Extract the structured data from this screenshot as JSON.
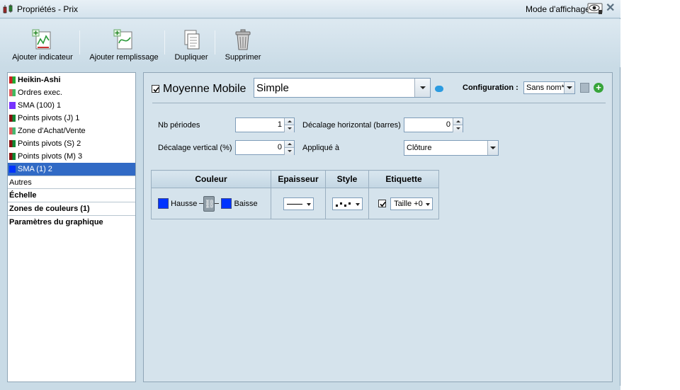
{
  "window": {
    "title": "Propriétés - Prix",
    "mode_label": "Mode d'affichage",
    "close_glyph": "✕"
  },
  "toolbar": {
    "add_indicator": "Ajouter indicateur",
    "add_fill": "Ajouter remplissage",
    "duplicate": "Dupliquer",
    "delete": "Supprimer"
  },
  "sidebar": {
    "items": [
      {
        "label": "Heikin-Ashi",
        "bold": true,
        "swatch": [
          "#cc2222",
          "#22aa33"
        ]
      },
      {
        "label": "Ordres exec.",
        "bold": false,
        "swatch": [
          "#e06060",
          "#40bb60"
        ]
      },
      {
        "label": "SMA (100) 1",
        "bold": false,
        "swatch": [
          "#7733ff",
          "#7733ff"
        ]
      },
      {
        "label": "Points pivots (J) 1",
        "bold": false,
        "swatch": [
          "#881111",
          "#118833"
        ]
      },
      {
        "label": "Zone d'Achat/Vente",
        "bold": false,
        "swatch": [
          "#e05a5a",
          "#45b870"
        ]
      },
      {
        "label": "Points pivots (S) 2",
        "bold": false,
        "swatch": [
          "#881111",
          "#118833"
        ]
      },
      {
        "label": "Points pivots (M) 3",
        "bold": false,
        "swatch": [
          "#881111",
          "#118833"
        ]
      },
      {
        "label": "SMA (1) 2",
        "bold": false,
        "selected": true,
        "swatch": [
          "#0033ff",
          "#0033ff"
        ]
      }
    ],
    "sections": [
      {
        "label": "Autres",
        "bold": false
      },
      {
        "label": "Échelle",
        "bold": true
      },
      {
        "label": "Zones de couleurs (1)",
        "bold": true
      },
      {
        "label": "Paramètres du graphique",
        "bold": true
      }
    ]
  },
  "indicator": {
    "enabled": true,
    "name": "Moyenne Mobile",
    "type": "Simple",
    "config_label": "Configuration :",
    "config_value": "Sans nom*"
  },
  "params": {
    "periods_label": "Nb périodes",
    "periods_value": "1",
    "hshift_label": "Décalage horizontal (barres)",
    "hshift_value": "0",
    "vshift_label": "Décalage vertical (%)",
    "vshift_value": "0",
    "applied_label": "Appliqué à",
    "applied_value": "Clôture"
  },
  "style_table": {
    "headers": [
      "Couleur",
      "Epaisseur",
      "Style",
      "Etiquette"
    ],
    "up_label": "Hausse",
    "down_label": "Baisse",
    "up_color": "#0033ff",
    "down_color": "#0033ff",
    "label_checked": true,
    "label_size": "Taille +0"
  }
}
